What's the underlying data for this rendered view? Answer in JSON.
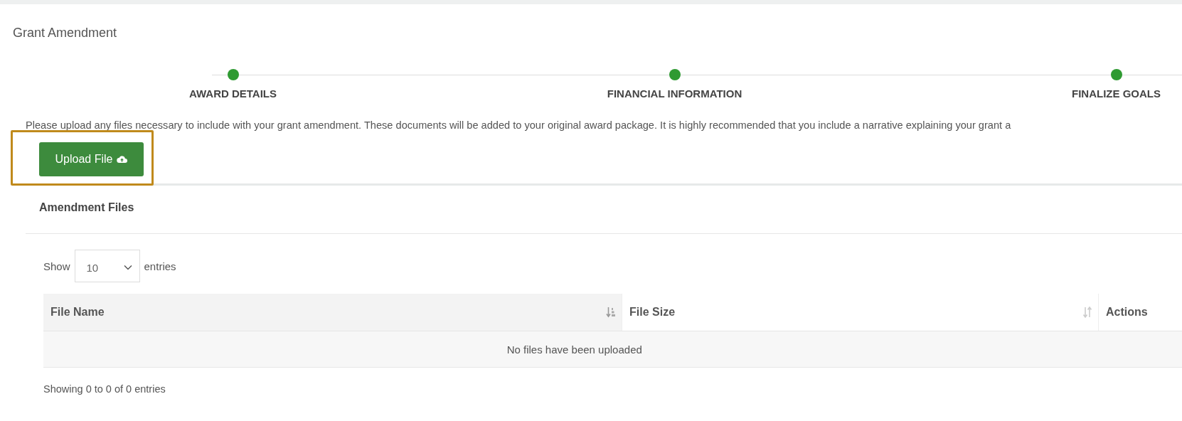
{
  "title": "Grant Amendment",
  "steps": [
    {
      "label": "AWARD DETAILS",
      "done": true
    },
    {
      "label": "FINANCIAL INFORMATION",
      "done": true
    },
    {
      "label": "FINALIZE GOALS",
      "done": true
    }
  ],
  "instructions": "Please upload any files necessary to include with your grant amendment. These documents will be added to your original award package. It is highly recommended that you include a narrative explaining your grant a",
  "upload_button": "Upload File",
  "files_panel": {
    "title": "Amendment Files",
    "show_label": "Show",
    "page_size": "10",
    "entries_label": "entries",
    "table": {
      "columns": [
        {
          "label": "File Name",
          "kind": "sorted"
        },
        {
          "label": "File Size",
          "kind": "sortable"
        },
        {
          "label": "Actions",
          "kind": "plain"
        }
      ],
      "empty_message": "No files have been uploaded"
    },
    "summary": "Showing 0 to 0 of 0 entries"
  }
}
